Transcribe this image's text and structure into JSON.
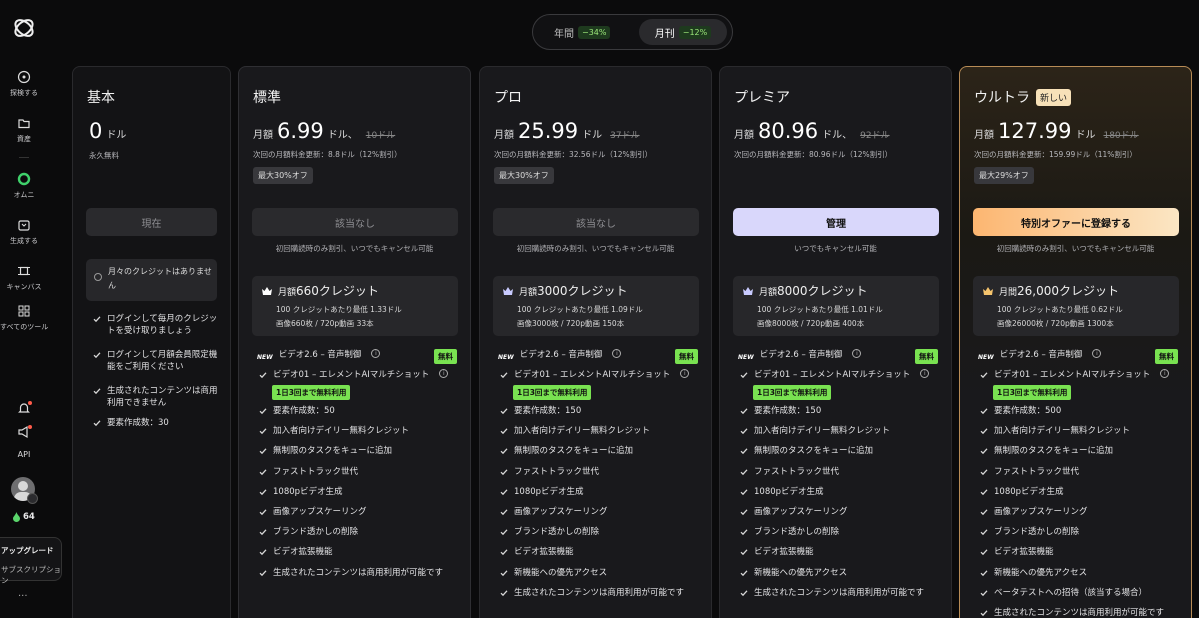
{
  "sidebar": {
    "items": [
      {
        "label": "探検する",
        "icon": "explore-icon"
      },
      {
        "label": "資産",
        "icon": "folder-icon"
      },
      {
        "label": "オムニ",
        "icon": "omni-icon"
      },
      {
        "label": "生成する",
        "icon": "generate-icon"
      },
      {
        "label": "キャンバス",
        "icon": "canvas-icon"
      },
      {
        "label": "すべてのツール",
        "icon": "grid-icon"
      }
    ],
    "api": "API",
    "credits": "64",
    "upgrade": "アップグレード",
    "subscription": "サブスクリプション",
    "more": "..."
  },
  "billing_toggle": {
    "yearly": "年間",
    "yearly_pct": "−34%",
    "monthly": "月刊",
    "monthly_pct": "−12%",
    "selected": "monthly"
  },
  "common": {
    "monthly_prefix": "月額",
    "unit": "ドル",
    "first_month_note": "初回購読時のみ割引、いつでもキャンセル可能",
    "free_badge": "無料",
    "daily_badge": "1日3回まで無料利用",
    "new_label": "NEW"
  },
  "plans": {
    "basic": {
      "name": "基本",
      "value": "0",
      "unit": "ドル",
      "forever": "永久無料",
      "button": "現在",
      "no_credits": "月々のクレジットはありません",
      "features": [
        "ログインして毎月のクレジットを受け取りましょう",
        "ログインして月額会員限定機能をご利用ください",
        "生成されたコンテンツは商用利用できません",
        "要素作成数：30"
      ]
    },
    "standard": {
      "name": "標準",
      "price": "6.99",
      "unit": "ドル、",
      "old": "10ドル",
      "renew": "次回の月額料金更新：8.8ドル（12%割引）",
      "off": "最大30%オフ",
      "button": "該当なし",
      "credit_prefix": "月額",
      "credit_title": "660クレジット",
      "credit_rate": "100 クレジットあたり最低 1.33ドル",
      "credit_media": "画像660枚 / 720p動画 33本",
      "features": [
        "ビデオ2.6 – 音声制御",
        "ビデオ01 – エレメントAIマルチショット",
        "要素作成数：50",
        "加入者向けデイリー無料クレジット",
        "無制限のタスクをキューに追加",
        "ファストトラック世代",
        "1080pビデオ生成",
        "画像アップスケーリング",
        "ブランド透かしの削除",
        "ビデオ拡張機能",
        "生成されたコンテンツは商用利用が可能です"
      ]
    },
    "pro": {
      "name": "プロ",
      "price": "25.99",
      "unit": "ドル",
      "old": "37ドル",
      "renew": "次回の月額料金更新：32.56ドル（12%割引）",
      "off": "最大30%オフ",
      "button": "該当なし",
      "credit_prefix": "月額",
      "credit_title": "3000クレジット",
      "credit_rate": "100 クレジットあたり最低 1.09ドル",
      "credit_media": "画像3000枚 / 720p動画 150本",
      "features": [
        "ビデオ2.6 – 音声制御",
        "ビデオ01 – エレメントAIマルチショット",
        "要素作成数：150",
        "加入者向けデイリー無料クレジット",
        "無制限のタスクをキューに追加",
        "ファストトラック世代",
        "1080pビデオ生成",
        "画像アップスケーリング",
        "ブランド透かしの削除",
        "ビデオ拡張機能",
        "新機能への優先アクセス",
        "生成されたコンテンツは商用利用が可能です"
      ]
    },
    "premier": {
      "name": "プレミア",
      "price": "80.96",
      "unit": "ドル、",
      "old": "92ドル",
      "renew": "次回の月額料金更新：80.96ドル（12%割引）",
      "button": "管理",
      "cancel": "いつでもキャンセル可能",
      "credit_prefix": "月額",
      "credit_title": "8000クレジット",
      "credit_rate": "100 クレジットあたり最低 1.01ドル",
      "credit_media": "画像8000枚 / 720p動画 400本",
      "features": [
        "ビデオ2.6 – 音声制御",
        "ビデオ01 – エレメントAIマルチショット",
        "要素作成数：150",
        "加入者向けデイリー無料クレジット",
        "無制限のタスクをキューに追加",
        "ファストトラック世代",
        "1080pビデオ生成",
        "画像アップスケーリング",
        "ブランド透かしの削除",
        "ビデオ拡張機能",
        "新機能への優先アクセス",
        "生成されたコンテンツは商用利用が可能です"
      ]
    },
    "ultra": {
      "name": "ウルトラ",
      "new_tag": "新しい",
      "price": "127.99",
      "unit": "ドル",
      "old": "180ドル",
      "renew": "次回の月額料金更新：159.99ドル（11%割引）",
      "off": "最大29%オフ",
      "button": "特別オファーに登録する",
      "credit_prefix": "月間",
      "credit_title": "26,000クレジット",
      "credit_rate": "100 クレジットあたり最低 0.62ドル",
      "credit_media": "画像26000枚 / 720p動画 1300本",
      "features": [
        "ビデオ2.6 – 音声制御",
        "ビデオ01 – エレメントAIマルチショット",
        "要素作成数：500",
        "加入者向けデイリー無料クレジット",
        "無制限のタスクをキューに追加",
        "ファストトラック世代",
        "1080pビデオ生成",
        "画像アップスケーリング",
        "ブランド透かしの削除",
        "ビデオ拡張機能",
        "新機能への優先アクセス",
        "ベータテストへの招待（該当する場合）",
        "生成されたコンテンツは商用利用が可能です"
      ]
    }
  },
  "colors": {
    "accent_green": "#79e251",
    "ultra_border": "#b88c56",
    "manage_button": "#d9d7fb"
  }
}
